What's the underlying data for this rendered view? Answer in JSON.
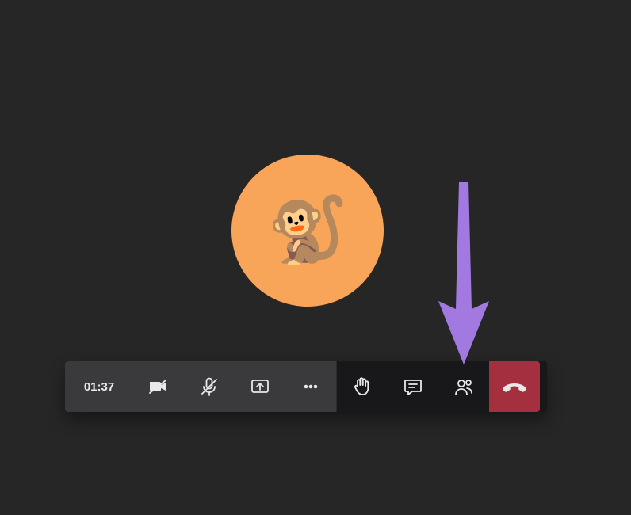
{
  "call": {
    "timer": "01:37",
    "participant_emoji": "🐒"
  },
  "annotation": {
    "arrow_color": "#a279e0",
    "target": "participants-button"
  },
  "colors": {
    "background": "#262626",
    "toolbar_dark": "#18181a",
    "toolbar_light": "#3a3a3c",
    "hangup": "#a4303f",
    "avatar_bg": "#f8a55a"
  }
}
